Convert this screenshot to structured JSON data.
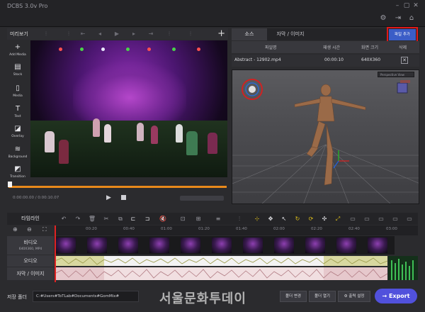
{
  "window": {
    "title": "DCBS 3.0v Pro"
  },
  "preview": {
    "label": "미리보기",
    "timecode": "0:00:00.00 / 0:00:10.07"
  },
  "tools": [
    {
      "label": "Add Media",
      "icon": "plus-icon"
    },
    {
      "label": "Stock",
      "icon": "stock-icon"
    },
    {
      "label": "Media",
      "icon": "media-icon"
    },
    {
      "label": "Text",
      "icon": "text-icon"
    },
    {
      "label": "Overlay",
      "icon": "overlay-icon"
    },
    {
      "label": "Background",
      "icon": "background-icon"
    },
    {
      "label": "Transition",
      "icon": "transition-icon"
    }
  ],
  "source_panel": {
    "tabs": [
      "소스",
      "자막 / 이미지"
    ],
    "add_file_label": "파일 추가",
    "columns": [
      "파일명",
      "재생 시간",
      "화면 크기",
      "삭제"
    ],
    "files": [
      {
        "name": "Abstract - 12902.mp4",
        "duration": "00:00:10",
        "size": "640X360"
      }
    ],
    "viewport_mode": "Perspective View"
  },
  "timeline": {
    "label": "타임라인",
    "ruler": [
      "00:20",
      "00:40",
      "01:00",
      "01:20",
      "01:40",
      "02:00",
      "02:20",
      "02:40",
      "03:00"
    ],
    "tracks": {
      "video": {
        "label": "비디오",
        "info": "640X360, MP4"
      },
      "audio": {
        "label": "오디오"
      },
      "subtitle": {
        "label": "자막 / 이미지"
      }
    }
  },
  "bottom": {
    "save_label": "저장 폴더",
    "save_path": "C:#Users#ToTLab#Documents#GomMix#",
    "change_folder": "폴더 변경",
    "open_folder": "폴더 열기",
    "output_settings": "출력 설정",
    "export_label": "Export",
    "watermark": "서울문화투데이"
  },
  "colors": {
    "accent_orange": "#e8891b",
    "add_file_blue": "#3b5dc7",
    "highlight_red": "#e01818",
    "export_purple": "#5151dc"
  }
}
